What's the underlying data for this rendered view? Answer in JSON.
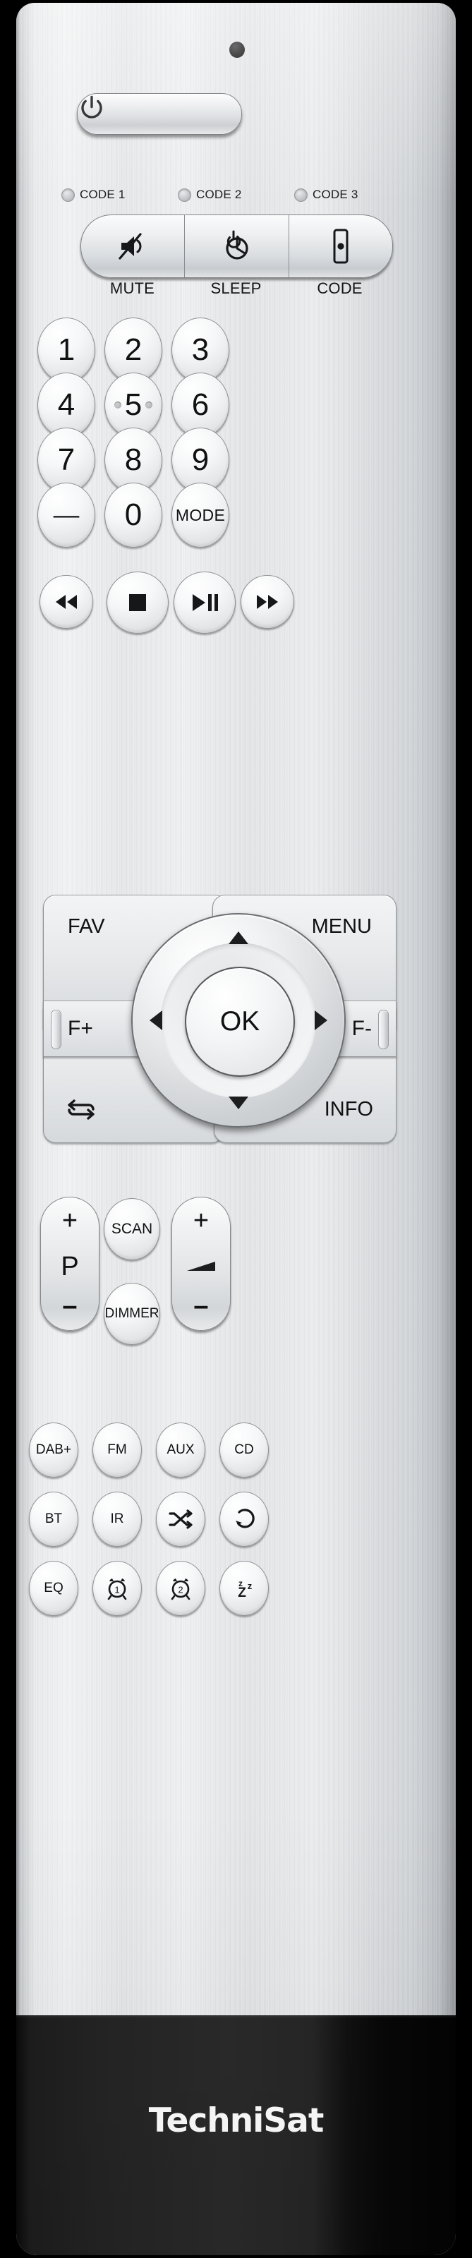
{
  "device": {
    "brand": "TechniSat",
    "ir_led": "ir-emitter"
  },
  "power": {
    "label": "",
    "icon": "power-icon"
  },
  "code_indicators": [
    {
      "label": "CODE 1"
    },
    {
      "label": "CODE 2"
    },
    {
      "label": "CODE 3"
    }
  ],
  "function_bar": {
    "buttons": [
      {
        "icon": "mute-icon",
        "sublabel": "MUTE"
      },
      {
        "icon": "sleep-timer-icon",
        "sublabel": "SLEEP"
      },
      {
        "icon": "remote-code-icon",
        "sublabel": "CODE"
      }
    ]
  },
  "keypad": {
    "rows": [
      [
        {
          "label": "1"
        },
        {
          "label": "2"
        },
        {
          "label": "3"
        }
      ],
      [
        {
          "label": "4"
        },
        {
          "label": "5",
          "tactile_dots": true
        },
        {
          "label": "6"
        }
      ],
      [
        {
          "label": "7"
        },
        {
          "label": "8"
        },
        {
          "label": "9"
        }
      ],
      [
        {
          "label": "––"
        },
        {
          "label": "0"
        },
        {
          "label": "MODE"
        }
      ]
    ]
  },
  "transport": [
    {
      "icon": "rewind-icon"
    },
    {
      "icon": "stop-icon"
    },
    {
      "icon": "play-pause-icon"
    },
    {
      "icon": "fast-forward-icon"
    }
  ],
  "navigation": {
    "corners": {
      "top_left": "FAV",
      "top_right": "MENU",
      "bottom_left_icon": "repeat-swap-icon",
      "bottom_right": "INFO"
    },
    "sides": {
      "left": "F+",
      "right": "F-"
    },
    "center": "OK",
    "arrows": {
      "up": "arrow-up-icon",
      "down": "arrow-down-icon",
      "left": "arrow-left-icon",
      "right": "arrow-right-icon"
    }
  },
  "middle_controls": {
    "program_rocker": {
      "plus": "+",
      "mid": "P",
      "minus": "–"
    },
    "scan": "SCAN",
    "dimmer": "DIMMER",
    "volume_rocker": {
      "plus": "+",
      "mid_icon": "volume-wedge-icon",
      "minus": "–"
    }
  },
  "sources": {
    "row1": [
      {
        "label": "DAB+"
      },
      {
        "label": "FM"
      },
      {
        "label": "AUX"
      },
      {
        "label": "CD"
      }
    ],
    "row2": [
      {
        "label": "BT"
      },
      {
        "label": "IR"
      },
      {
        "label": "",
        "icon": "shuffle-icon"
      },
      {
        "label": "",
        "icon": "repeat-icon"
      }
    ],
    "row3": [
      {
        "label": "EQ"
      },
      {
        "label": "",
        "icon": "alarm-1-icon"
      },
      {
        "label": "",
        "icon": "alarm-2-icon"
      },
      {
        "label": "",
        "icon": "sleep-zzz-icon"
      }
    ]
  },
  "colors": {
    "body_metal": "#e6e8ea",
    "footer_black": "#1d1d1d",
    "key_face": "#f0f2f3",
    "text": "#111111"
  }
}
